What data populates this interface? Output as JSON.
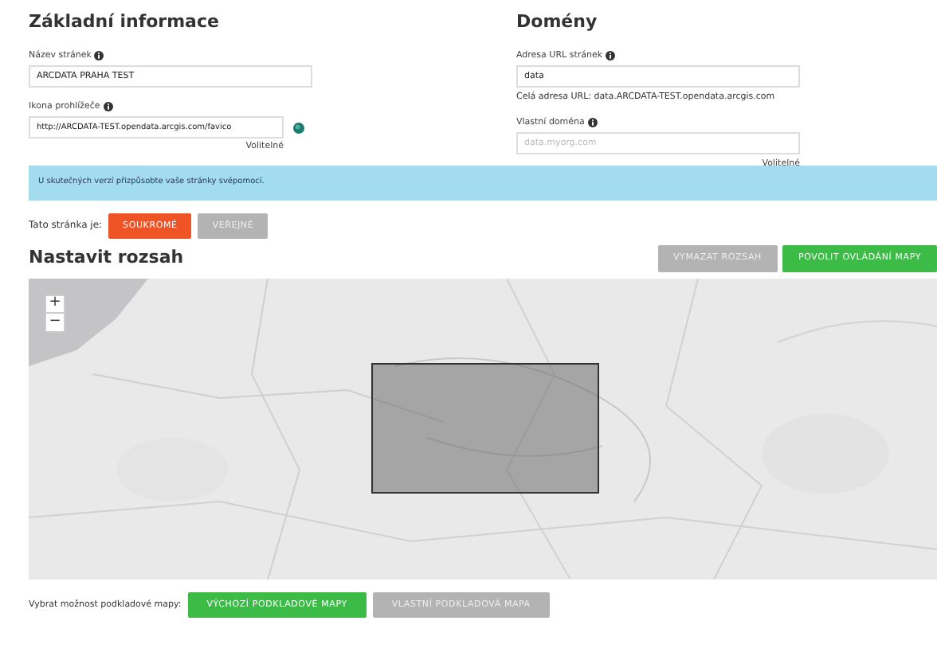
{
  "basic_info": {
    "title": "Základní informace",
    "fields": [
      {
        "label": "Název stránek",
        "value": "ARCDATA PRAHA TEST",
        "has_icon": false
      },
      {
        "label": "Ikona prohlížeče",
        "value": "http://ARCDATA-TEST.opendata.arcgis.com/favico",
        "has_icon": true,
        "note": "Volitelné"
      }
    ],
    "alert": "U skutečných verzí přizpůsobte vaše stránky svépomocí.",
    "visibility": {
      "label": "Tato stránka je:",
      "options": [
        {
          "label": "SOUKROMÉ",
          "selected": true
        },
        {
          "label": "VEŘEJNÉ",
          "selected": false
        }
      ]
    }
  },
  "domains": {
    "title": "Domény",
    "fields": [
      {
        "label": "Adresa URL stránek",
        "value": "data",
        "help": "Celá adresa URL: data.ARCDATA-TEST.opendata.arcgis.com"
      },
      {
        "label": "Vlastní doména",
        "placeholder": "data.myorg.com",
        "note": "Volitelné"
      }
    ]
  },
  "extent": {
    "title": "Nastavit rozsah",
    "buttons": [
      {
        "label": "VYMAZAT ROZSAH",
        "disabled": true
      },
      {
        "label": "POVOLIT OVLÁDÁNÍ MAPY",
        "disabled": false
      }
    ],
    "map": {
      "kind": "picture",
      "zoom": [
        "+",
        "−"
      ]
    }
  },
  "basemap": {
    "label": "Vybrat možnost podkladové mapy:",
    "options": [
      {
        "label": "VÝCHOZÍ PODKLADOVÉ MAPY",
        "selected": true
      },
      {
        "label": "VLASTNÍ PODKLADOVÁ MAPA",
        "selected": false
      }
    ]
  }
}
